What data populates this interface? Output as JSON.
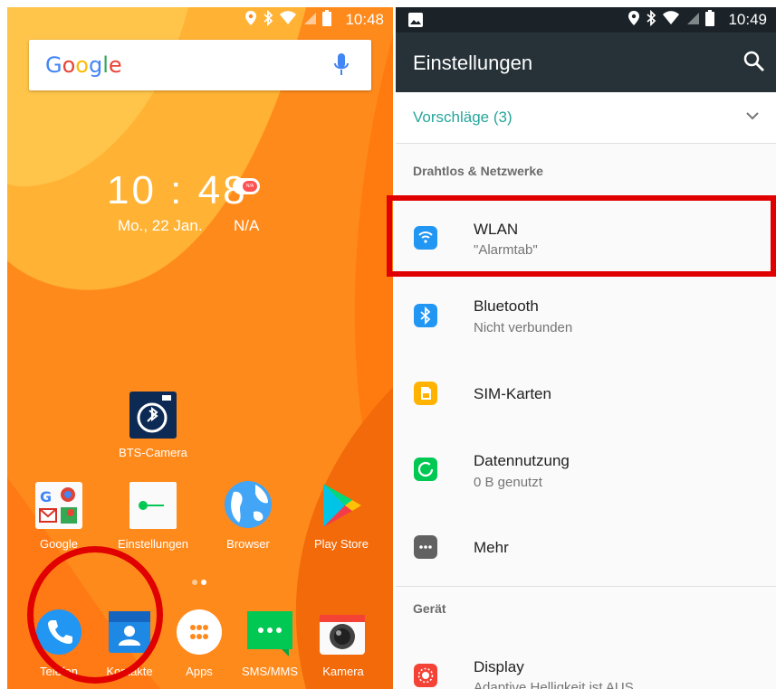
{
  "home": {
    "status_time": "10:48",
    "search_logo": "Google",
    "clock": "10 : 48",
    "alarm_badge": "N/A",
    "date": "Mo., 22 Jan.",
    "weather": "N/A",
    "bts_camera_label": "BTS-Camera",
    "row_apps": [
      {
        "label": "Google"
      },
      {
        "label": "Einstellungen"
      },
      {
        "label": "Browser"
      },
      {
        "label": "Play Store"
      }
    ],
    "dock": [
      {
        "label": "Telefon"
      },
      {
        "label": "Kontakte"
      },
      {
        "label": "Apps"
      },
      {
        "label": "SMS/MMS"
      },
      {
        "label": "Kamera"
      }
    ]
  },
  "settings": {
    "status_time": "10:49",
    "title": "Einstellungen",
    "suggestions": "Vorschläge (3)",
    "section_wireless": "Drahtlos & Netzwerke",
    "items": [
      {
        "title": "WLAN",
        "subtitle": "\"Alarmtab\"",
        "icon": "wifi-icon",
        "color": "#2196f3"
      },
      {
        "title": "Bluetooth",
        "subtitle": "Nicht verbunden",
        "icon": "bluetooth-icon",
        "color": "#2196f3"
      },
      {
        "title": "SIM-Karten",
        "subtitle": "",
        "icon": "sim-card-icon",
        "color": "#ffb300"
      },
      {
        "title": "Datennutzung",
        "subtitle": "0 B genutzt",
        "icon": "data-usage-icon",
        "color": "#00c853"
      },
      {
        "title": "Mehr",
        "subtitle": "",
        "icon": "more-icon",
        "color": "#616161"
      }
    ],
    "section_device": "Gerät",
    "display": {
      "title": "Display",
      "subtitle": "Adaptive Helligkeit ist AUS",
      "icon": "display-icon",
      "color": "#f44336"
    }
  },
  "colors": {
    "accent_teal": "#26a69a",
    "toolbar": "#263238",
    "home_orange": "#ff8a1c",
    "highlight_red": "#e00000"
  }
}
